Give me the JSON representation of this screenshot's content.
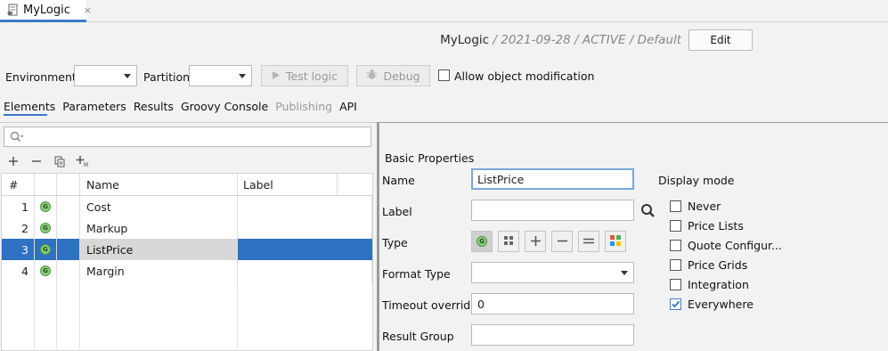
{
  "app": {
    "tab_title": "MyLogic",
    "tab_close": "×"
  },
  "header": {
    "name": "MyLogic",
    "date": "2021-09-28",
    "status": "ACTIVE",
    "variant": "Default",
    "separator": "/",
    "edit_label": "Edit"
  },
  "toolbar": {
    "environment_label": "Environment:",
    "environment_value": "",
    "partition_label": "Partition:",
    "partition_value": "",
    "test_logic_label": "Test logic",
    "debug_label": "Debug",
    "allow_mod_label": "Allow object modification",
    "allow_mod_checked": false
  },
  "sections": {
    "tabs": [
      {
        "label": "Elements",
        "active": true
      },
      {
        "label": "Parameters"
      },
      {
        "label": "Results"
      },
      {
        "label": "Groovy Console"
      },
      {
        "label": "Publishing",
        "disabled": true
      },
      {
        "label": "API"
      }
    ]
  },
  "elements": {
    "search_value": "",
    "columns": {
      "num": "#",
      "name": "Name",
      "label": "Label"
    },
    "badge": "G",
    "rows": [
      {
        "num": "1",
        "name": "Cost",
        "label": ""
      },
      {
        "num": "2",
        "name": "Markup",
        "label": ""
      },
      {
        "num": "3",
        "name": "ListPrice",
        "label": "",
        "selected": true
      },
      {
        "num": "4",
        "name": "Margin",
        "label": ""
      }
    ]
  },
  "properties": {
    "section_title": "Basic Properties",
    "name_label": "Name",
    "name_value": "ListPrice",
    "label_label": "Label",
    "label_value": "",
    "type_label": "Type",
    "format_type_label": "Format Type",
    "format_type_value": "",
    "timeout_label": "Timeout override",
    "timeout_value": "0",
    "result_group_label": "Result Group",
    "result_group_value": ""
  },
  "display_mode": {
    "title": "Display mode",
    "options": [
      {
        "label": "Never",
        "checked": false
      },
      {
        "label": "Price Lists",
        "checked": false
      },
      {
        "label": "Quote Configur...",
        "checked": false
      },
      {
        "label": "Price Grids",
        "checked": false
      },
      {
        "label": "Integration",
        "checked": false
      },
      {
        "label": "Everywhere",
        "checked": true
      }
    ]
  },
  "colors": {
    "accent": "#3d7bc7",
    "selection": "#2e72c2",
    "badge_green": "#8fca80"
  }
}
